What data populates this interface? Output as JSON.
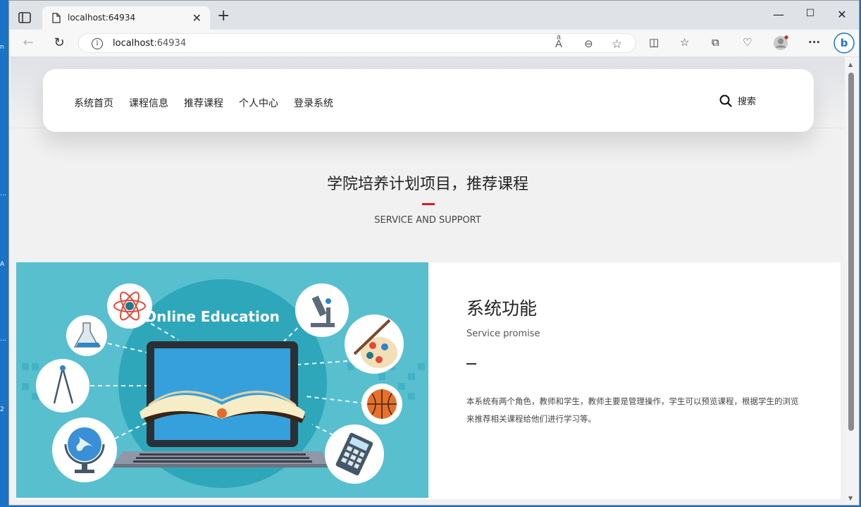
{
  "browser": {
    "tab_title": "localhost:64934",
    "url_host": "localhost",
    "url_port": ":64934",
    "window_min": "—",
    "window_max": "☐",
    "window_close": "✕",
    "new_tab": "+"
  },
  "nav": {
    "menu": [
      "系统首页",
      "课程信息",
      "推荐课程",
      "个人中心",
      "登录系统"
    ],
    "search_label": "搜索"
  },
  "section": {
    "title": "学院培养计划项目，推荐课程",
    "subtitle": "SERVICE AND SUPPORT"
  },
  "feature": {
    "image_title": "Online Education",
    "title": "系统功能",
    "subtitle": "Service promise",
    "body": "本系统有两个角色，教师和学生，教师主要是管理操作，学生可以预览课程，根据学生的浏览来推荐相关课程给他们进行学习等。"
  },
  "colors": {
    "accent_red": "#d61e1e",
    "image_bg": "#58bfcf"
  }
}
